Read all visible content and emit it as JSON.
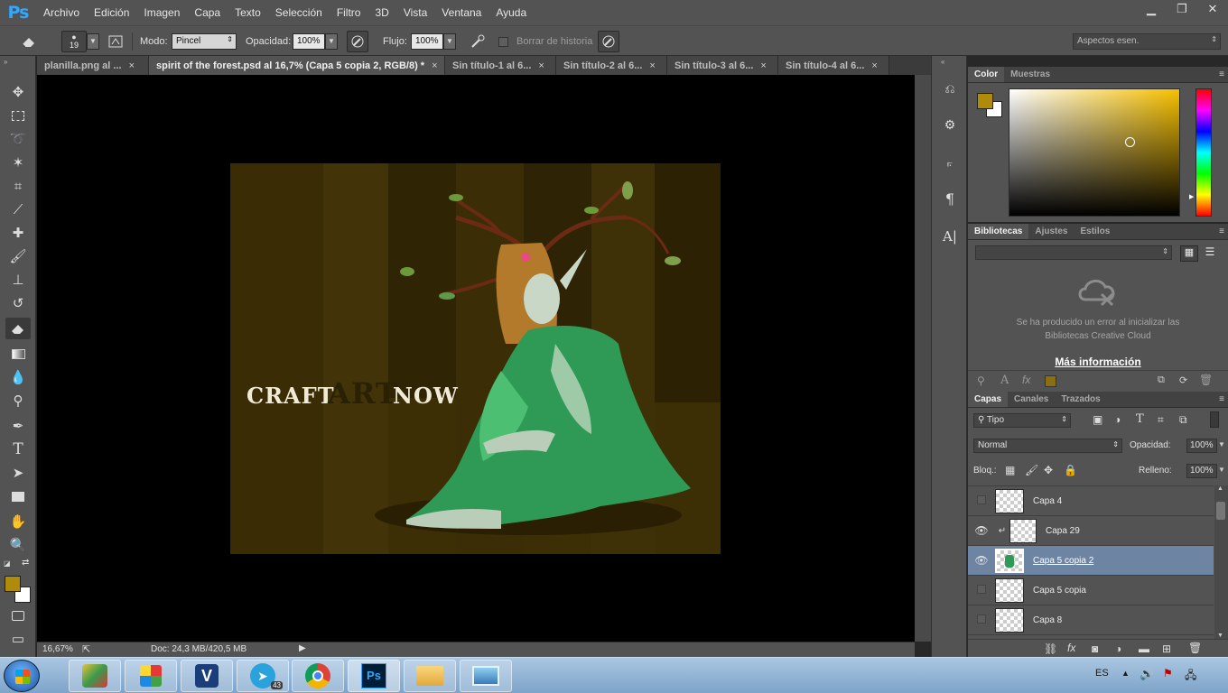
{
  "app": {
    "logo": "Ps"
  },
  "menu": [
    "Archivo",
    "Edición",
    "Imagen",
    "Capa",
    "Texto",
    "Selección",
    "Filtro",
    "3D",
    "Vista",
    "Ventana",
    "Ayuda"
  ],
  "window_controls": {
    "minimize": "▁",
    "restore": "❐",
    "close": "✕"
  },
  "options": {
    "brush_size": "19",
    "mode_label": "Modo:",
    "mode_value": "Pincel",
    "opacity_label": "Opacidad:",
    "opacity_value": "100%",
    "flow_label": "Flujo:",
    "flow_value": "100%",
    "erase_history_label": "Borrar de historia",
    "workspace": "Aspectos esen."
  },
  "tabs": [
    {
      "label": "planilla.png al ...",
      "active": false
    },
    {
      "label": "spirit of the forest.psd al 16,7% (Capa 5 copia 2, RGB/8) *",
      "active": true
    },
    {
      "label": "Sin título-1 al 6...",
      "active": false
    },
    {
      "label": "Sin título-2 al 6...",
      "active": false
    },
    {
      "label": "Sin título-3 al 6...",
      "active": false
    },
    {
      "label": "Sin título-4 al 6...",
      "active": false
    }
  ],
  "tab_close": "×",
  "artwork": {
    "word1": "CRAFT",
    "word2": "ART",
    "word3": "NOW"
  },
  "status": {
    "zoom": "16,67%",
    "doc": "Doc: 24,3 MB/420,5 MB"
  },
  "colors": {
    "foreground": "#b08a0a",
    "background": "#ffffff",
    "accent": "#31a8ff",
    "selected_layer": "#6e84a3"
  },
  "color_panel": {
    "tabs": [
      "Color",
      "Muestras"
    ]
  },
  "libraries_panel": {
    "tabs": [
      "Bibliotecas",
      "Ajustes",
      "Estilos"
    ],
    "error_line1": "Se ha producido un error al inicializar las",
    "error_line2": "Bibliotecas Creative Cloud",
    "more_info": "Más información"
  },
  "layers_panel": {
    "tabs": [
      "Capas",
      "Canales",
      "Trazados"
    ],
    "filter": "Tipo",
    "blend": "Normal",
    "opacity_label": "Opacidad:",
    "opacity_value": "100%",
    "lock_label": "Bloq.:",
    "fill_label": "Relleno:",
    "fill_value": "100%",
    "layers": [
      {
        "name": "Capa 4",
        "visible": false,
        "selected": false,
        "clipped": false
      },
      {
        "name": "Capa 29",
        "visible": true,
        "selected": false,
        "clipped": true
      },
      {
        "name": "Capa 5 copia 2",
        "visible": true,
        "selected": true,
        "clipped": false
      },
      {
        "name": "Capa 5 copia",
        "visible": false,
        "selected": false,
        "clipped": false
      },
      {
        "name": "Capa 8",
        "visible": false,
        "selected": false,
        "clipped": false
      }
    ]
  },
  "tray": {
    "language": "ES",
    "telegram_badge": "43"
  }
}
